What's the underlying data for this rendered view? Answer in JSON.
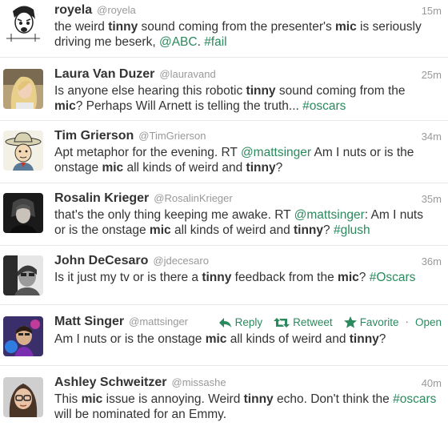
{
  "colors": {
    "link": "#2a8a5e",
    "text": "#333333",
    "meta": "#999999",
    "divider": "#e8e8e8"
  },
  "tweets": [
    {
      "name": "royela",
      "handle": "@royela",
      "time": "15m",
      "avatar_icon": "cartoon-face-avatar",
      "segments": [
        {
          "t": "the weird "
        },
        {
          "t": "tinny",
          "b": true
        },
        {
          "t": " sound coming from the presenter's "
        },
        {
          "t": "mic",
          "b": true
        },
        {
          "t": " is seriously driving me beserk, "
        },
        {
          "t": "@ABC",
          "link": true
        },
        {
          "t": ". "
        },
        {
          "t": "#fail",
          "link": true
        }
      ]
    },
    {
      "name": "Laura Van Duzer",
      "handle": "@lauravand",
      "time": "25m",
      "avatar_icon": "blonde-woman-photo-avatar",
      "segments": [
        {
          "t": "Is anyone else hearing this robotic "
        },
        {
          "t": "tinny",
          "b": true
        },
        {
          "t": " sound coming from the "
        },
        {
          "t": "mic",
          "b": true
        },
        {
          "t": "? Perhaps Will Arnett is telling the truth... "
        },
        {
          "t": "#oscars",
          "link": true
        }
      ]
    },
    {
      "name": "Tim Grierson",
      "handle": "@TimGrierson",
      "time": "34m",
      "avatar_icon": "cowboy-cartoon-avatar",
      "segments": [
        {
          "t": "Apt metaphor for the evening. RT "
        },
        {
          "t": "@mattsinger",
          "link": true
        },
        {
          "t": " Am I nuts or is the onstage "
        },
        {
          "t": "mic",
          "b": true
        },
        {
          "t": " all kinds of weird and "
        },
        {
          "t": "tinny",
          "b": true
        },
        {
          "t": "?"
        }
      ]
    },
    {
      "name": "Rosalin Krieger",
      "handle": "@RosalinKrieger",
      "time": "35m",
      "avatar_icon": "dark-portrait-avatar",
      "segments": [
        {
          "t": "that's the only thing keeping me awake. RT "
        },
        {
          "t": "@mattsinger",
          "link": true
        },
        {
          "t": ": Am I nuts or is the onstage "
        },
        {
          "t": "mic",
          "b": true
        },
        {
          "t": " all kinds of weird and "
        },
        {
          "t": "tinny",
          "b": true
        },
        {
          "t": "? "
        },
        {
          "t": "#glush",
          "link": true
        }
      ]
    },
    {
      "name": "John DeCesaro",
      "handle": "@jdecesaro",
      "time": "36m",
      "avatar_icon": "bw-portrait-avatar",
      "segments": [
        {
          "t": "Is it just my tv or is there a "
        },
        {
          "t": "tinny",
          "b": true
        },
        {
          "t": " feedback from the "
        },
        {
          "t": "mic",
          "b": true
        },
        {
          "t": "? "
        },
        {
          "t": "#Oscars",
          "link": true
        }
      ]
    },
    {
      "name": "Matt Singer",
      "handle": "@mattsinger",
      "time": "",
      "avatar_icon": "colorful-portrait-avatar",
      "actions": {
        "reply": "Reply",
        "retweet": "Retweet",
        "favorite": "Favorite",
        "separator": "·",
        "open": "Open"
      },
      "segments": [
        {
          "t": "Am I nuts or is the onstage "
        },
        {
          "t": "mic",
          "b": true
        },
        {
          "t": " all kinds of weird and "
        },
        {
          "t": "tinny",
          "b": true
        },
        {
          "t": "?"
        }
      ]
    },
    {
      "name": "Ashley Schweitzer",
      "handle": "@missashe",
      "time": "40m",
      "avatar_icon": "woman-glasses-avatar",
      "segments": [
        {
          "t": "This "
        },
        {
          "t": "mic",
          "b": true
        },
        {
          "t": " issue is annoying. Weird "
        },
        {
          "t": "tinny",
          "b": true
        },
        {
          "t": " echo. Don't think the "
        },
        {
          "t": "#oscars",
          "link": true
        },
        {
          "t": " will be nominated for an Emmy."
        }
      ]
    }
  ]
}
